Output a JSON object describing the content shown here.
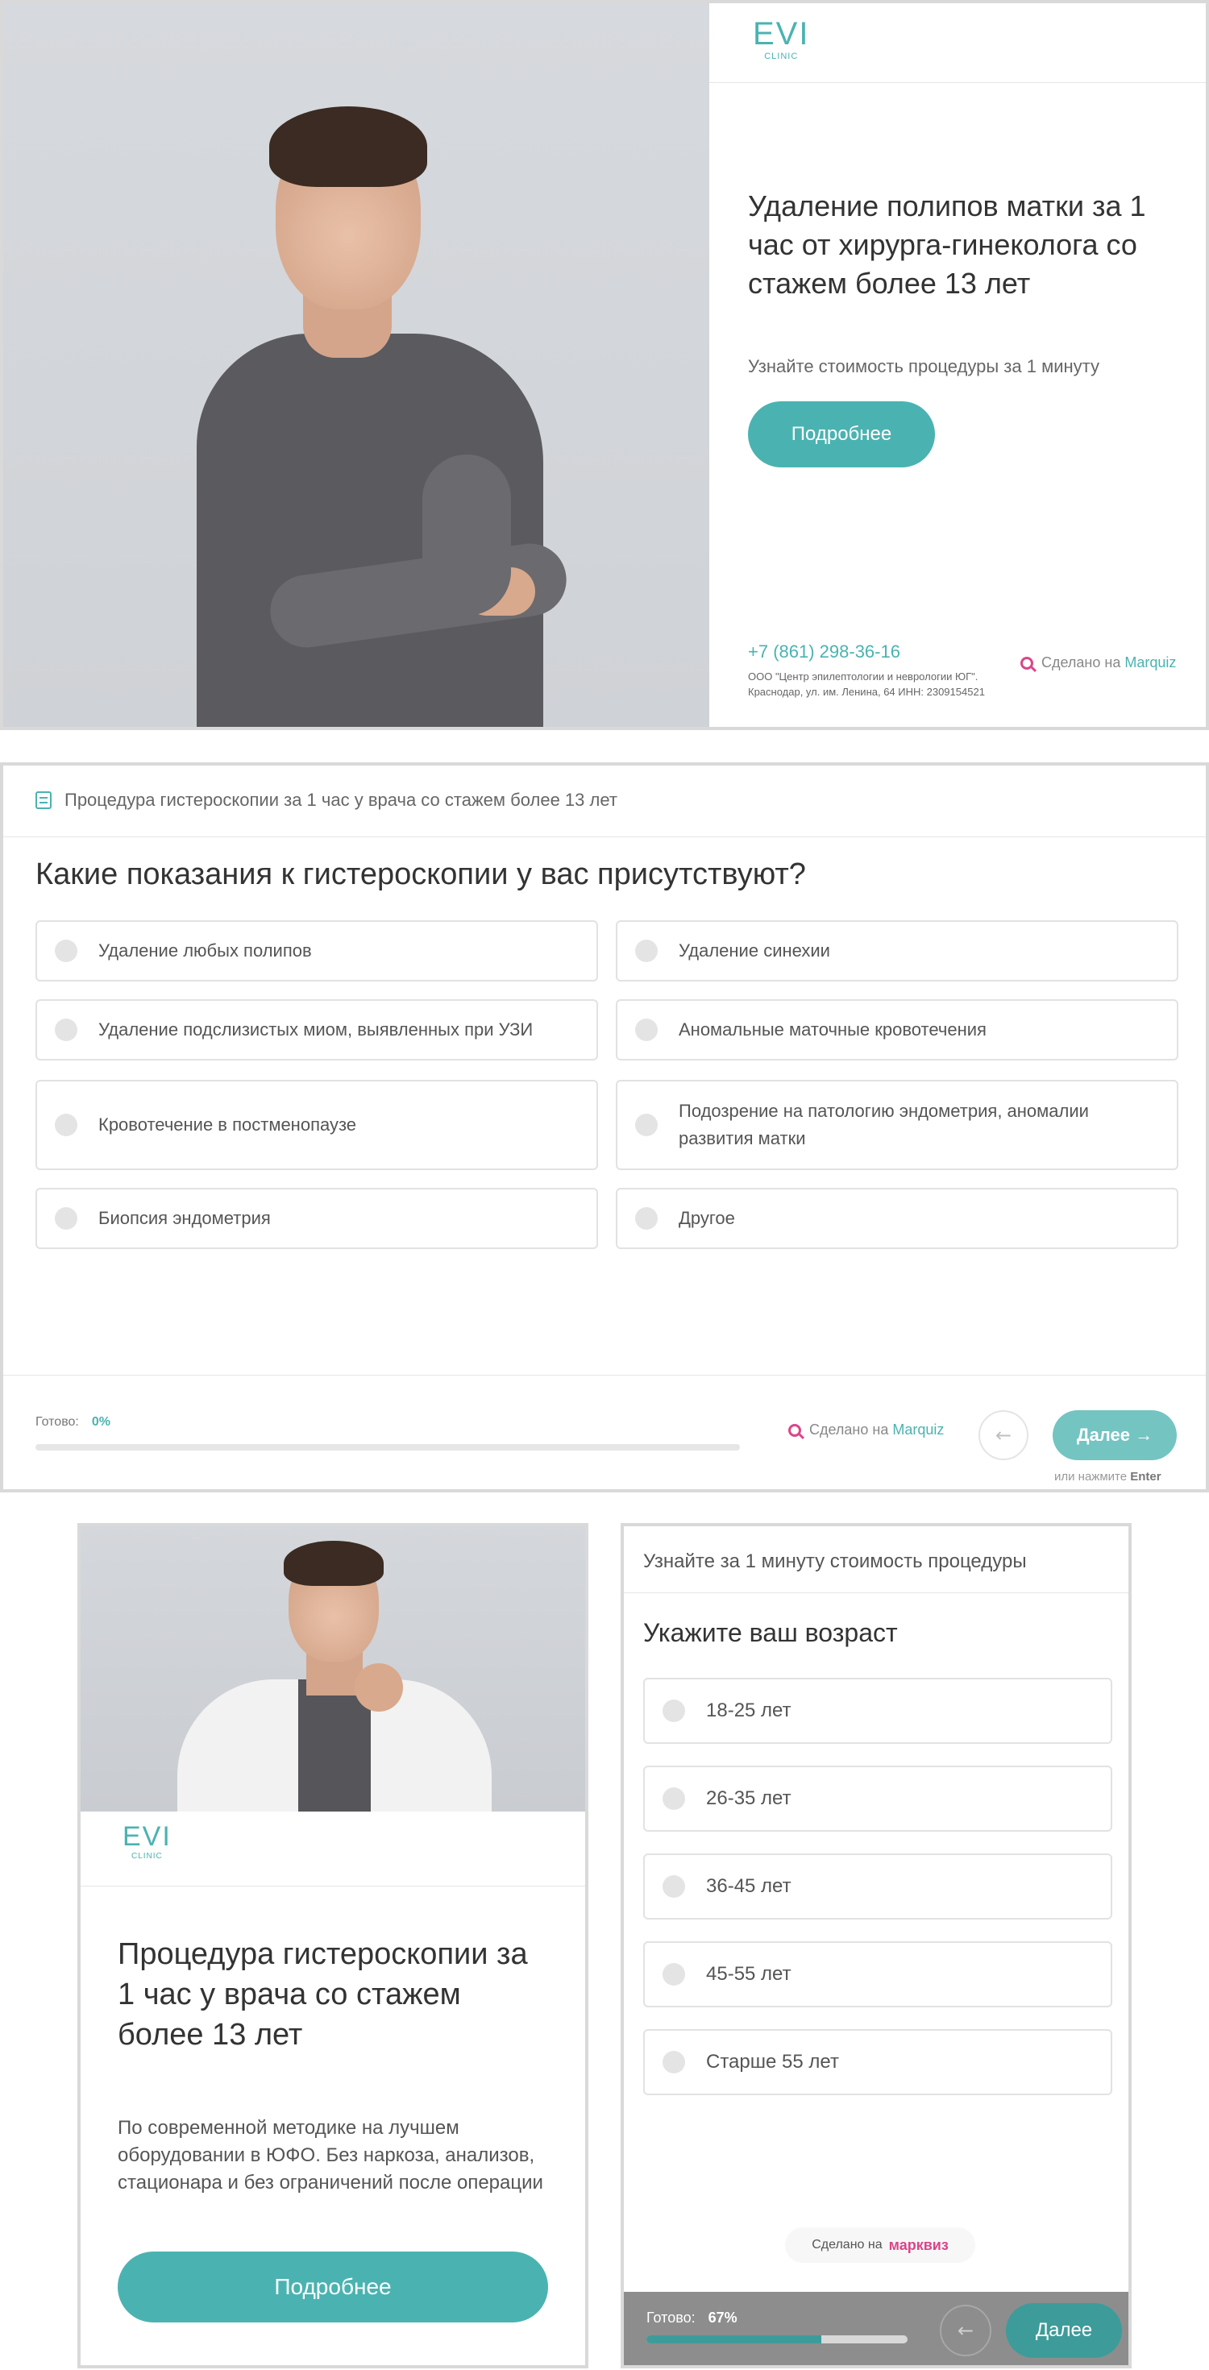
{
  "colors": {
    "accent": "#4ab3b1",
    "brand_pink": "#d9468a"
  },
  "screen1": {
    "logo_mark": "EVI",
    "logo_sub": "CLINIC",
    "title": "Удаление полипов матки за 1 час от хирурга-гинеколога со стажем более 13 лет",
    "subtitle": "Узнайте стоимость процедуры за 1 минуту",
    "button": "Подробнее",
    "phone": "+7 (861) 298-36-16",
    "company": "ООО \"Центр эпилептологии и неврологии ЮГ\". Краснодар, ул. им. Ленина, 64 ИНН: 2309154521",
    "made_prefix": "Сделано на",
    "made_brand": "Marquiz"
  },
  "screen2": {
    "header": "Процедура гистероскопии за 1 час у врача со стажем более 13 лет",
    "question": "Какие показания к гистероскопии у вас присутствуют?",
    "options": [
      "Удаление любых полипов",
      "Удаление синехии",
      "Удаление подслизистых миом, выявленных при УЗИ",
      "Аномальные маточные кровотечения",
      "Кровотечение в постменопаузе",
      "Подозрение на патологию эндометрия, аномалии развития матки",
      "Биопсия эндометрия",
      "Другое"
    ],
    "ready_label": "Готово:",
    "progress_text": "0%",
    "progress_value": 0,
    "made_prefix": "Сделано на",
    "made_brand": "Marquiz",
    "back_icon": "arrow-left-icon",
    "next_label": "Далее",
    "enter_hint_prefix": "или нажмите",
    "enter_hint_key": "Enter"
  },
  "screen3": {
    "logo_mark": "EVI",
    "logo_sub": "CLINIC",
    "title": "Процедура гистероскопии за 1 час у врача со стажем более 13 лет",
    "description": "По современной методике на лучшем оборудовании в ЮФО. Без наркоза, анализов, стационара и без ограничений после операции",
    "button": "Подробнее"
  },
  "screen4": {
    "header": "Узнайте за 1 минуту стоимость процедуры",
    "question": "Укажите ваш возраст",
    "options": [
      "18-25 лет",
      "26-35 лет",
      "36-45 лет",
      "45-55 лет",
      "Старше 55 лет"
    ],
    "made_prefix": "Сделано на",
    "made_brand": "марквиз",
    "ready_label": "Готово:",
    "progress_text": "67%",
    "progress_value": 0.67,
    "next_label": "Далее"
  }
}
